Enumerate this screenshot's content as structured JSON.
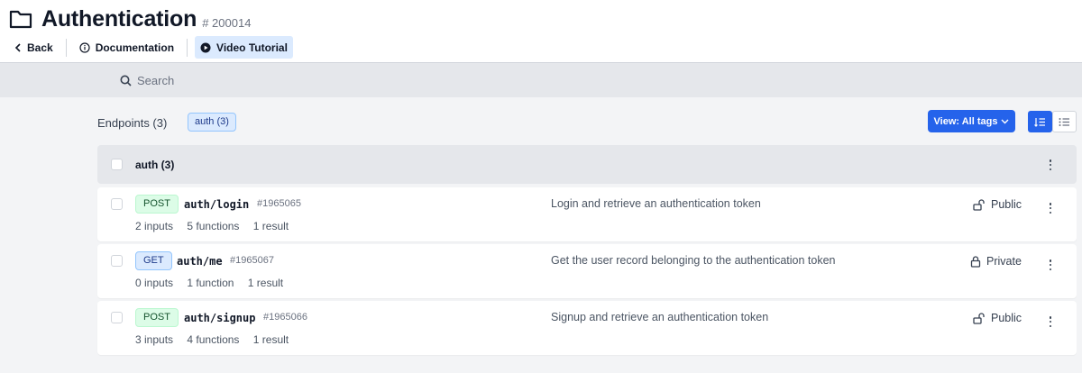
{
  "header": {
    "title": "Authentication",
    "id": "# 200014",
    "nav": {
      "back": "Back",
      "docs": "Documentation",
      "video": "Video Tutorial"
    }
  },
  "search": {
    "placeholder": "Search"
  },
  "toolbar": {
    "endpoints": "Endpoints (3)",
    "tag": "auth (3)",
    "view": "View: All tags"
  },
  "group": {
    "label": "auth (3)"
  },
  "endpoints": [
    {
      "method": "POST",
      "path": "auth/login",
      "id": "#1965065",
      "inputs": "2 inputs",
      "functions": "5 functions",
      "results": "1 result",
      "description": "Login and retrieve an authentication token",
      "access": "Public"
    },
    {
      "method": "GET",
      "path": "auth/me",
      "id": "#1965067",
      "inputs": "0 inputs",
      "functions": "1 function",
      "results": "1 result",
      "description": "Get the user record belonging to the authentication token",
      "access": "Private"
    },
    {
      "method": "POST",
      "path": "auth/signup",
      "id": "#1965066",
      "inputs": "3 inputs",
      "functions": "4 functions",
      "results": "1 result",
      "description": "Signup and retrieve an authentication token",
      "access": "Public"
    }
  ],
  "colors": {
    "accent": "#2563eb",
    "post": "#dcfce7",
    "get": "#dbeafe"
  }
}
